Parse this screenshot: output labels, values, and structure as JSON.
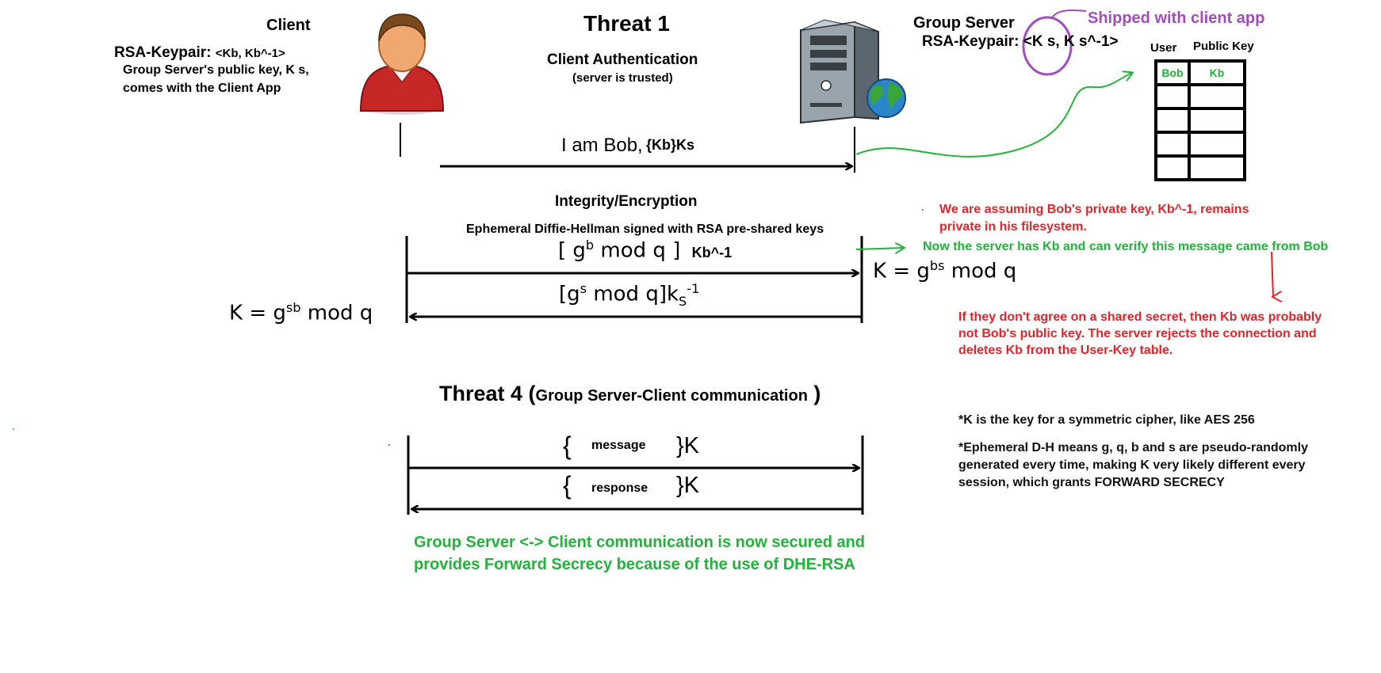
{
  "client": {
    "title": "Client",
    "keypair_label": "RSA-Keypair:",
    "keypair_value": "<Kb, Kb^-1>",
    "note_line1": "Group Server's public key, K  s,",
    "note_line2": "comes with the Client App"
  },
  "threat1": {
    "title": "Threat 1",
    "auth_title": "Client  Authentication",
    "auth_sub": "(server is trusted)",
    "msg_plain": "I am Bob,",
    "msg_enc": "{Kb}Ks"
  },
  "server": {
    "title": "Group Server",
    "keypair": "RSA-Keypair: <K  s, K  s^-1>",
    "shipped": "Shipped with client app",
    "table_header_user": "User",
    "table_header_key": "Public Key",
    "table_rows": [
      [
        "Bob",
        "Kb"
      ],
      [
        "",
        ""
      ],
      [
        "",
        ""
      ],
      [
        "",
        ""
      ],
      [
        "",
        ""
      ]
    ]
  },
  "integrity": {
    "title": "Integrity/Encryption",
    "subtitle": "Ephemeral Diffie-Hellman signed with RSA pre-shared keys",
    "msg1_pre": "[ g",
    "msg1_sup": "b",
    "msg1_post": " mod q ]",
    "msg1_sig": "Kb^-1",
    "msg2_pre": "[g",
    "msg2_sup": "s",
    "msg2_post": " mod q]k",
    "msg2_sub": "S",
    "msg2_sup2": "-1",
    "client_key_pre": "K = g",
    "client_key_sup": "sb",
    "client_key_post": " mod q",
    "server_key_pre": "K = g",
    "server_key_sup": "bs",
    "server_key_post": " mod q"
  },
  "red_notes": {
    "assume_line1": "We are assuming Bob's private key, Kb^-1, remains",
    "assume_line2": "private in his filesystem.",
    "reject": "If they don't agree on a shared secret, then Kb was probably not Bob's public key. The server rejects the connection and deletes Kb from the User-Key table."
  },
  "green_notes": {
    "verify": "Now the server has Kb and can verify this message came from Bob",
    "conclusion_line1": "Group Server <-> Client communication is now secured and",
    "conclusion_line2": "provides Forward Secrecy because of the use of DHE-RSA"
  },
  "threat4": {
    "title": "Threat 4 (",
    "title_sub": "Group Server-Client communication",
    "title_end": " )",
    "msg": "message",
    "resp": "response",
    "open_brace": "{",
    "close_brace_k": "}K"
  },
  "notes": {
    "k_note": "*K is the key for a symmetric cipher, like AES 256",
    "ephemeral": "*Ephemeral D-H means g, q, b and s are pseudo-randomly generated every time, making K very likely different every session, which grants FORWARD SECRECY"
  },
  "colors": {
    "red": "#e3242b",
    "green": "#22b33a",
    "purple": "#a44bbd",
    "person_shirt": "#c62828",
    "skin": "#f0a870"
  },
  "icons": [
    "person-icon",
    "server-computer-icon",
    "globe-icon"
  ]
}
